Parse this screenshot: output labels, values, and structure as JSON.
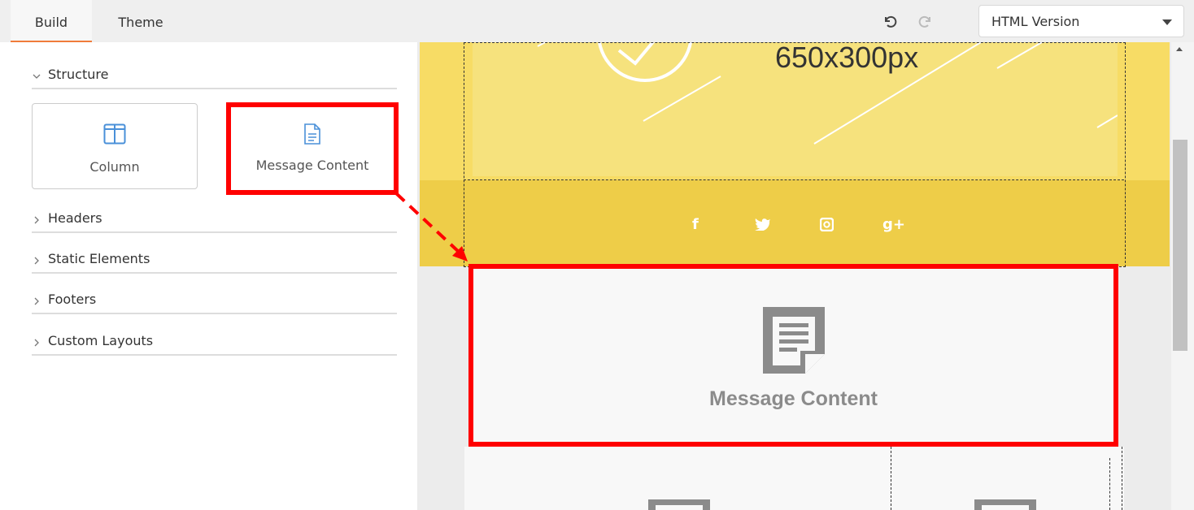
{
  "toolbar": {
    "tabs": [
      {
        "label": "Build",
        "active": true
      },
      {
        "label": "Theme",
        "active": false
      }
    ],
    "undo_icon": "undo-icon",
    "redo_icon": "redo-icon",
    "version_select": {
      "value": "HTML Version"
    }
  },
  "sidebar": {
    "sections": [
      {
        "label": "Structure",
        "expanded": true
      },
      {
        "label": "Headers",
        "expanded": false
      },
      {
        "label": "Static Elements",
        "expanded": false
      },
      {
        "label": "Footers",
        "expanded": false
      },
      {
        "label": "Custom Layouts",
        "expanded": false
      }
    ],
    "structure_items": [
      {
        "label": "Column",
        "icon": "column-layout-icon"
      },
      {
        "label": "Message Content",
        "icon": "document-icon"
      }
    ]
  },
  "canvas": {
    "hero_placeholder": "650x300px",
    "social_icons": [
      "facebook-icon",
      "twitter-icon",
      "instagram-icon",
      "google-plus-icon"
    ],
    "dropped_block_label": "Message Content"
  },
  "colors": {
    "accent": "#f07c3a",
    "highlight": "#ff0000",
    "hero_bg": "#f7dc65",
    "social_bg": "#eecd48"
  }
}
